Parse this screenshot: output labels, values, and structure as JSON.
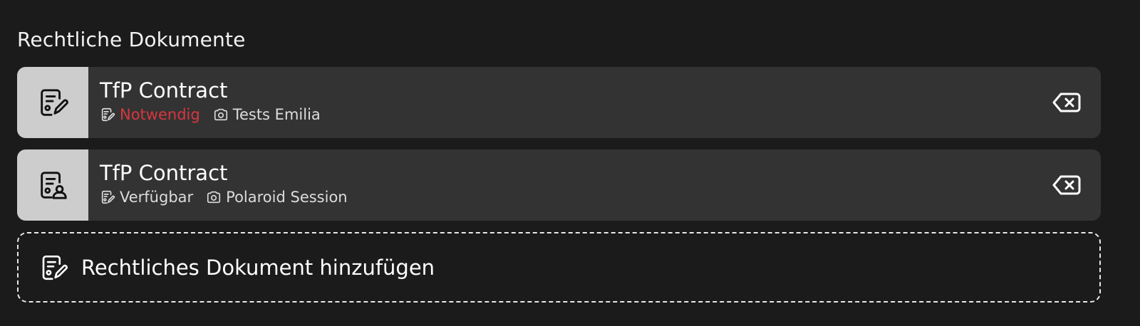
{
  "section": {
    "title": "Rechtliche Dokumente"
  },
  "documents": [
    {
      "title": "TfP Contract",
      "status": "Notwendig",
      "status_color": "#d9363e",
      "session": "Tests Emilia",
      "thumb_icon": "document-sign-icon"
    },
    {
      "title": "TfP Contract",
      "status": "Verfügbar",
      "status_color": "#dcdcdc",
      "session": "Polaroid Session",
      "thumb_icon": "document-person-icon"
    }
  ],
  "add_document": {
    "label": "Rechtliches Dokument hinzufügen",
    "icon": "document-sign-icon"
  },
  "colors": {
    "background": "#1b1b1b",
    "card": "#333333",
    "thumb": "#cdcdcd",
    "required": "#d9363e"
  }
}
